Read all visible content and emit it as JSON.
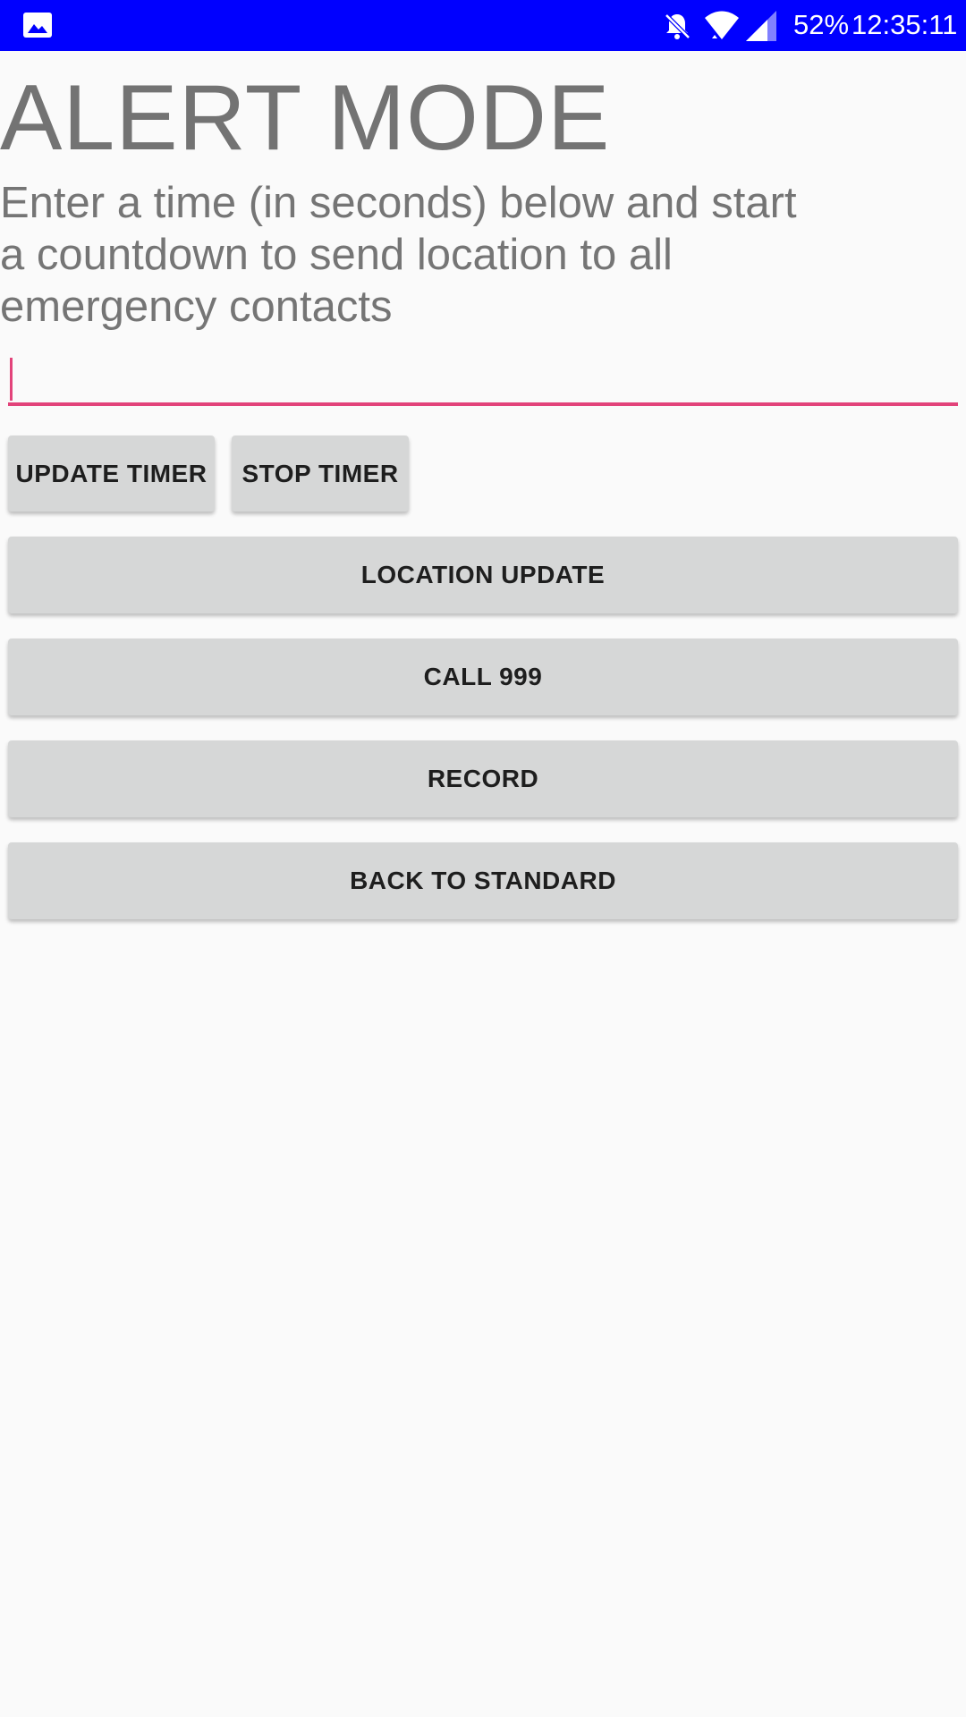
{
  "status_bar": {
    "background_color": "#0000ff",
    "left_icon": "gallery-icon",
    "icons": [
      "bell-off-icon",
      "wifi-icon",
      "signal-icon"
    ],
    "battery": "52%",
    "time": "12:35:11"
  },
  "main": {
    "title": "ALERT MODE",
    "description": "Enter a time (in seconds) below and start a countdown to send location to all emergency contacts",
    "seconds_input": {
      "value": "",
      "placeholder": ""
    },
    "accent_color": "#e2437a",
    "buttons": {
      "update_timer": "UPDATE TIMER",
      "stop_timer": "STOP TIMER",
      "location_update": "LOCATION UPDATE",
      "call": "CALL 999",
      "record": "RECORD",
      "back_to_standard": "BACK TO STANDARD"
    }
  }
}
